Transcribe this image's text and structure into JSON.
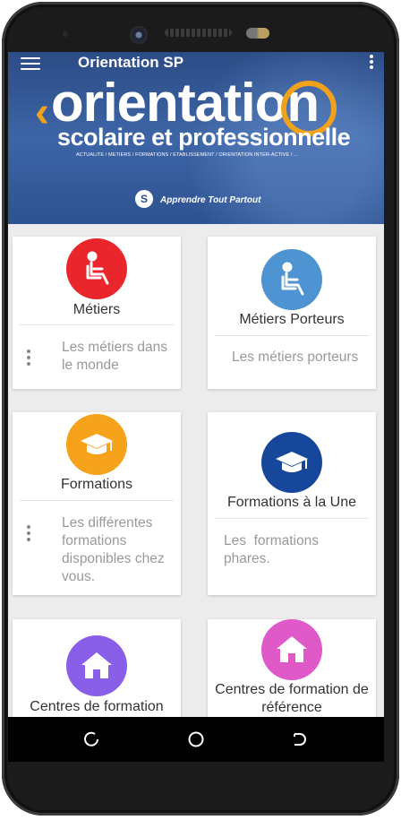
{
  "app_bar": {
    "title": "Orientation SP",
    "menu_icon": "hamburger-menu-icon",
    "overflow_icon": "more-vertical-icon"
  },
  "banner": {
    "brand_title": "orientation",
    "brand_subtitle": "scolaire et professionnelle",
    "tagline": "ACTUALITE / METIERS / FORMATIONS / ETABLISSEMENT / ORIENTATION INTER-ACTIVE / ...",
    "slogan": "Apprendre Tout Partout",
    "accent_color": "#f1a21a"
  },
  "cards": [
    {
      "title": "Métiers",
      "description": "Les métiers dans le monde",
      "icon": "seated-person-icon",
      "color": "#e8262b"
    },
    {
      "title": "Métiers Porteurs",
      "description": "Les métiers porteurs",
      "icon": "seated-person-icon",
      "color": "#4e93d2"
    },
    {
      "title": "Formations",
      "description": "Les différentes formations disponibles chez vous.",
      "icon": "graduation-cap-icon",
      "color": "#f7a21b"
    },
    {
      "title": "Formations à la Une",
      "description": "Les  formations phares.",
      "icon": "graduation-cap-icon",
      "color": "#17479a"
    },
    {
      "title": "Centres de formation",
      "description": "",
      "icon": "home-icon",
      "color": "#8a5fe8"
    },
    {
      "title": "Centres de formation de référence",
      "description": "",
      "icon": "home-icon",
      "color": "#e059c8"
    }
  ],
  "navbar": {
    "back_icon": "back-arrow-icon",
    "home_icon": "home-circle-icon",
    "recents_icon": "recents-icon"
  }
}
